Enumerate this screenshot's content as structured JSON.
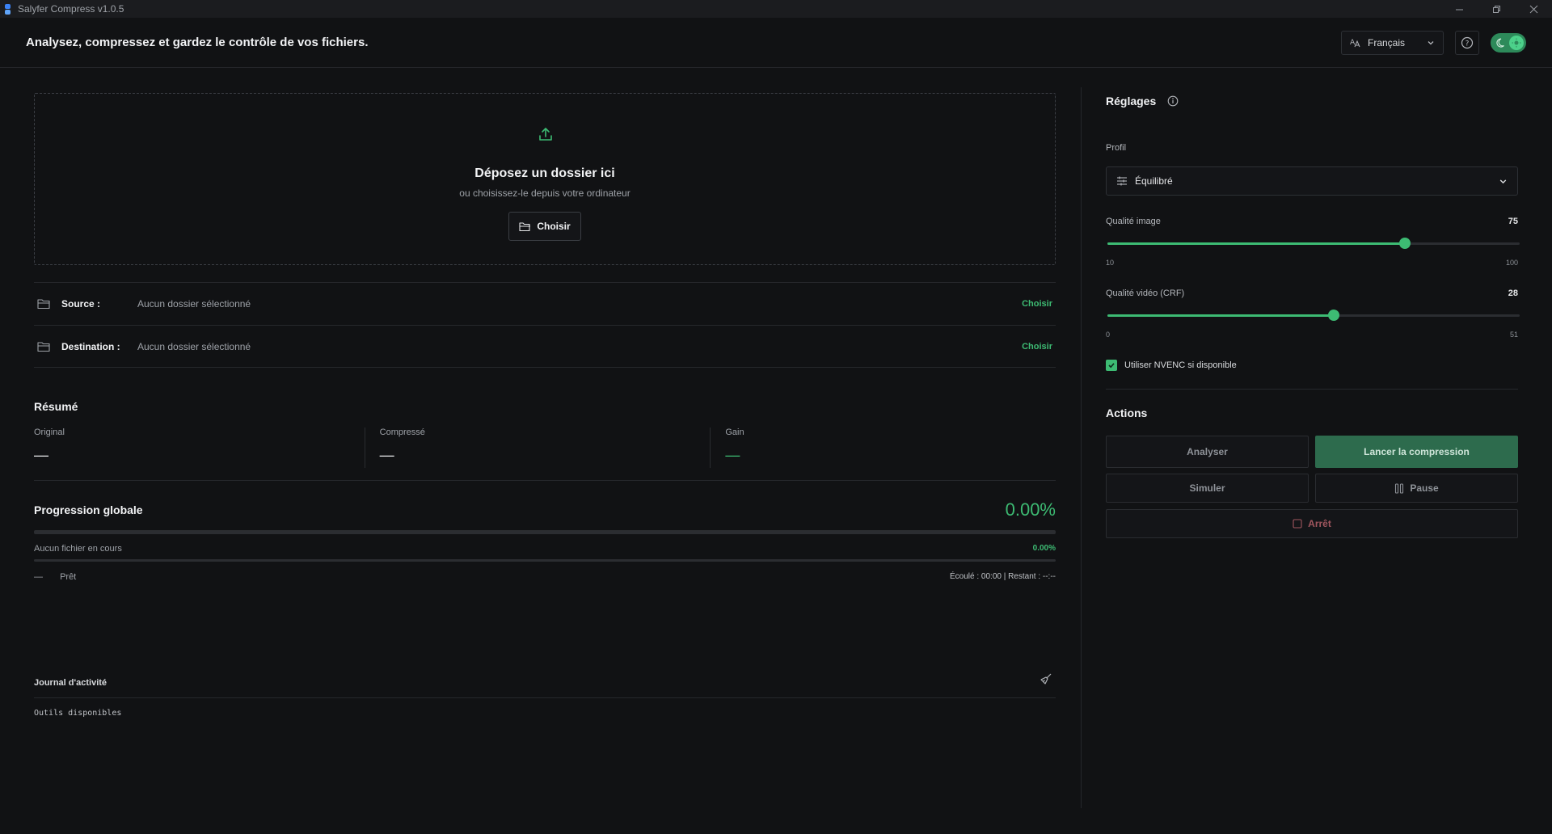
{
  "window": {
    "title": "Salyfer Compress v1.0.5"
  },
  "header": {
    "tagline": "Analysez, compressez et gardez le contrôle de vos fichiers.",
    "language": "Français"
  },
  "dropzone": {
    "title": "Déposez un dossier ici",
    "subtitle": "ou choisissez-le depuis votre ordinateur",
    "button": "Choisir"
  },
  "paths": {
    "source": {
      "label": "Source :",
      "value": "Aucun dossier sélectionné",
      "action": "Choisir"
    },
    "destination": {
      "label": "Destination :",
      "value": "Aucun dossier sélectionné",
      "action": "Choisir"
    }
  },
  "summary": {
    "title": "Résumé",
    "original": {
      "label": "Original",
      "value": "—"
    },
    "compressed": {
      "label": "Compressé",
      "value": "—"
    },
    "gain": {
      "label": "Gain",
      "value": "—"
    }
  },
  "progress": {
    "title": "Progression globale",
    "global_percent": "0.00%",
    "global_fraction": 0,
    "current_file": "Aucun fichier en cours",
    "file_percent": "0.00%",
    "file_fraction": 0,
    "status_dash": "—",
    "status": "Prêt",
    "timing": "Écoulé : 00:00 | Restant : --:--"
  },
  "journal": {
    "title": "Journal d'activité",
    "lines": [
      "Outils disponibles"
    ]
  },
  "settings": {
    "title": "Réglages",
    "profile_label": "Profil",
    "profile_value": "Équilibré",
    "image_quality": {
      "label": "Qualité image",
      "value": 75,
      "min": 10,
      "max": 100
    },
    "video_quality": {
      "label": "Qualité vidéo (CRF)",
      "value": 28,
      "min": 0,
      "max": 51
    },
    "nvenc_label": "Utiliser NVENC si disponible",
    "nvenc_checked": true
  },
  "actions": {
    "title": "Actions",
    "analyze": "Analyser",
    "start": "Lancer la compression",
    "simulate": "Simuler",
    "pause": "Pause",
    "stop": "Arrêt"
  },
  "colors": {
    "accent": "#3dbb73",
    "background": "#111214",
    "stop": "#a0565e"
  }
}
